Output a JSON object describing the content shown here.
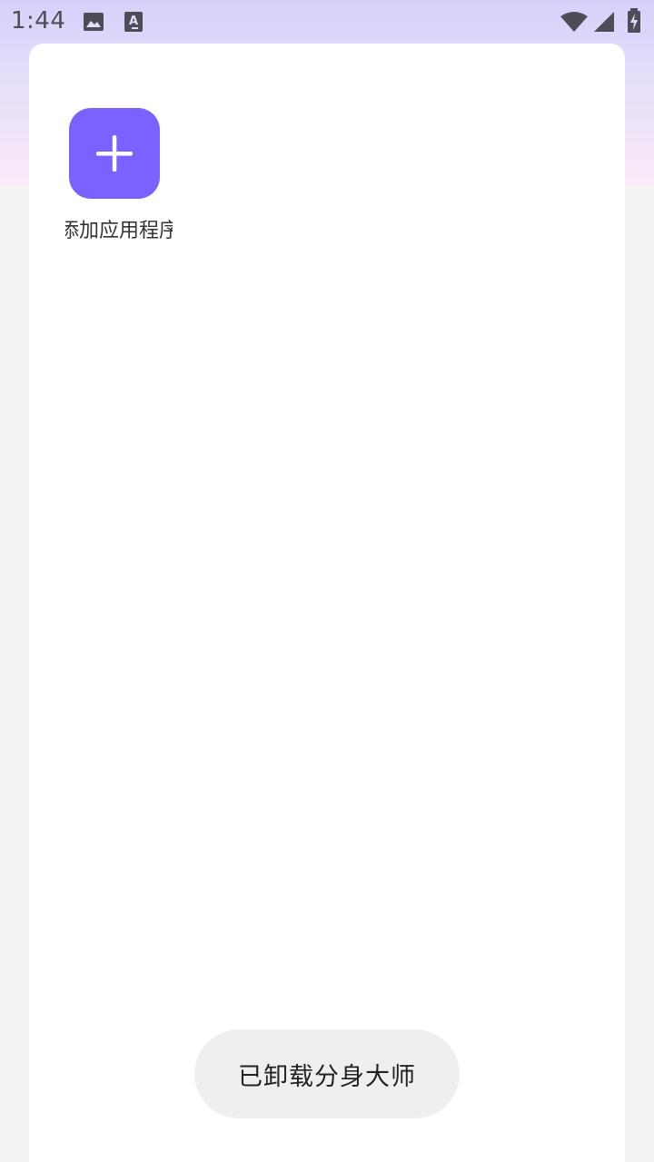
{
  "status_bar": {
    "time": "1:44",
    "icons": [
      "image-icon",
      "text-a-icon",
      "wifi-icon",
      "signal-icon",
      "battery-charging-icon"
    ]
  },
  "main": {
    "add_app": {
      "label": "添加应用程序",
      "icon": "plus-icon"
    }
  },
  "toast": {
    "message": "已卸载分身大师"
  },
  "colors": {
    "accent": "#7b61ff",
    "background": "#f3f3f4",
    "card": "#ffffff",
    "toast_bg": "#efefef",
    "gradient_top": "#d8d0fb",
    "gradient_bottom": "#fbeaf7"
  }
}
